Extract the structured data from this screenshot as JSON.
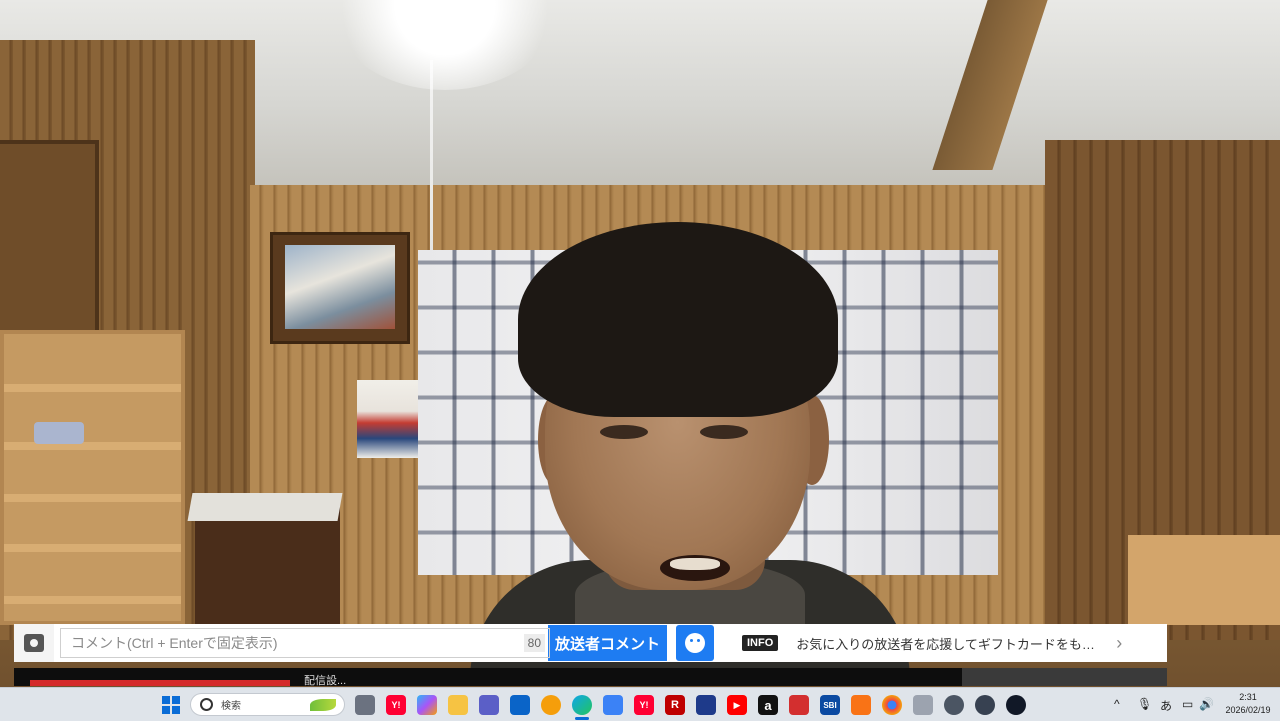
{
  "comment_bar": {
    "placeholder": "コメント(Ctrl + Enterで固定表示)",
    "char_count": "80",
    "broadcaster_button": "放送者コメント",
    "info_badge": "INFO",
    "info_text": "お気に入りの放送者を応援してギフトカードをも…",
    "chevron": "›"
  },
  "player_strip": {
    "title_fragment": "配信設..."
  },
  "taskbar": {
    "search_label": "検索",
    "apps": [
      {
        "name": "task-view-icon",
        "label": ""
      },
      {
        "name": "yahoo-icon",
        "label": "Y!"
      },
      {
        "name": "copilot-icon",
        "label": ""
      },
      {
        "name": "file-explorer-icon",
        "label": ""
      },
      {
        "name": "teams-icon",
        "label": ""
      },
      {
        "name": "outlook-icon",
        "label": ""
      },
      {
        "name": "photos-icon",
        "label": ""
      },
      {
        "name": "edge-icon",
        "label": ""
      },
      {
        "name": "store-icon",
        "label": ""
      },
      {
        "name": "yahoo-icon-2",
        "label": "Y!"
      },
      {
        "name": "rakuten-icon",
        "label": "R"
      },
      {
        "name": "news-icon",
        "label": ""
      },
      {
        "name": "youtube-icon",
        "label": "▶"
      },
      {
        "name": "amazon-icon",
        "label": "a"
      },
      {
        "name": "game-icon",
        "label": ""
      },
      {
        "name": "sbi-icon",
        "label": "SBI"
      },
      {
        "name": "mail-icon",
        "label": ""
      },
      {
        "name": "chrome-icon",
        "label": ""
      },
      {
        "name": "puzzle-icon",
        "label": ""
      },
      {
        "name": "clock-app-icon",
        "label": ""
      },
      {
        "name": "obs-icon",
        "label": ""
      },
      {
        "name": "camera-app-icon",
        "label": ""
      }
    ],
    "tray": {
      "chevron": "^",
      "ime": "あ",
      "time": "2:31",
      "date": "2026/02/19"
    }
  }
}
